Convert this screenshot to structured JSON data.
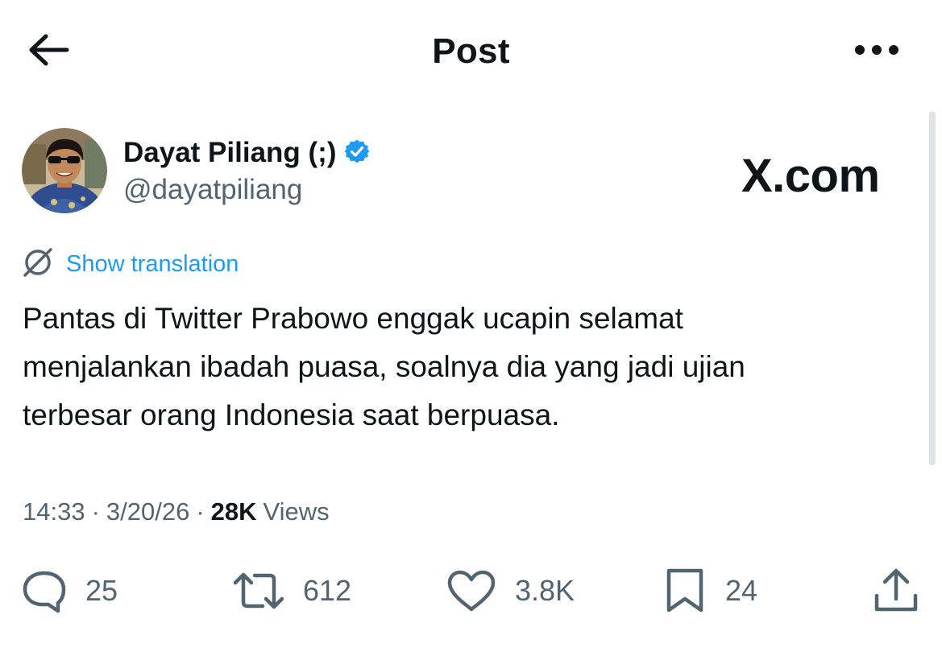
{
  "header": {
    "title": "Post",
    "back_icon": "arrow-left-icon",
    "more_icon": "more-horizontal-icon"
  },
  "author": {
    "display_name": "Dayat Piliang (;)",
    "handle": "@dayatpiliang",
    "verified_icon": "verified-badge-icon",
    "verified_color": "#1d9bf0"
  },
  "watermark": "X.com",
  "translation": {
    "icon": "translate-globe-icon",
    "label": "Show translation",
    "color": "#1d9bf0"
  },
  "post": {
    "text": "Pantas di Twitter Prabowo enggak ucapin selamat\nmenjalankan ibadah puasa, soalnya dia yang jadi ujian\nterbesar orang Indonesia saat berpuasa.",
    "time": "14:33",
    "date": "3/20/26",
    "separator": "·",
    "views_count": "28K",
    "views_label": "Views"
  },
  "actions": {
    "replies": {
      "icon": "reply-bubble-icon",
      "count": "25"
    },
    "reposts": {
      "icon": "repost-icon",
      "count": "612"
    },
    "likes": {
      "icon": "heart-icon",
      "count": "3.8K"
    },
    "bookmarks": {
      "icon": "bookmark-icon",
      "count": "24"
    },
    "share": {
      "icon": "share-icon"
    }
  },
  "colors": {
    "text_primary": "#0f1419",
    "text_secondary": "#536471",
    "accent": "#1d9bf0"
  }
}
